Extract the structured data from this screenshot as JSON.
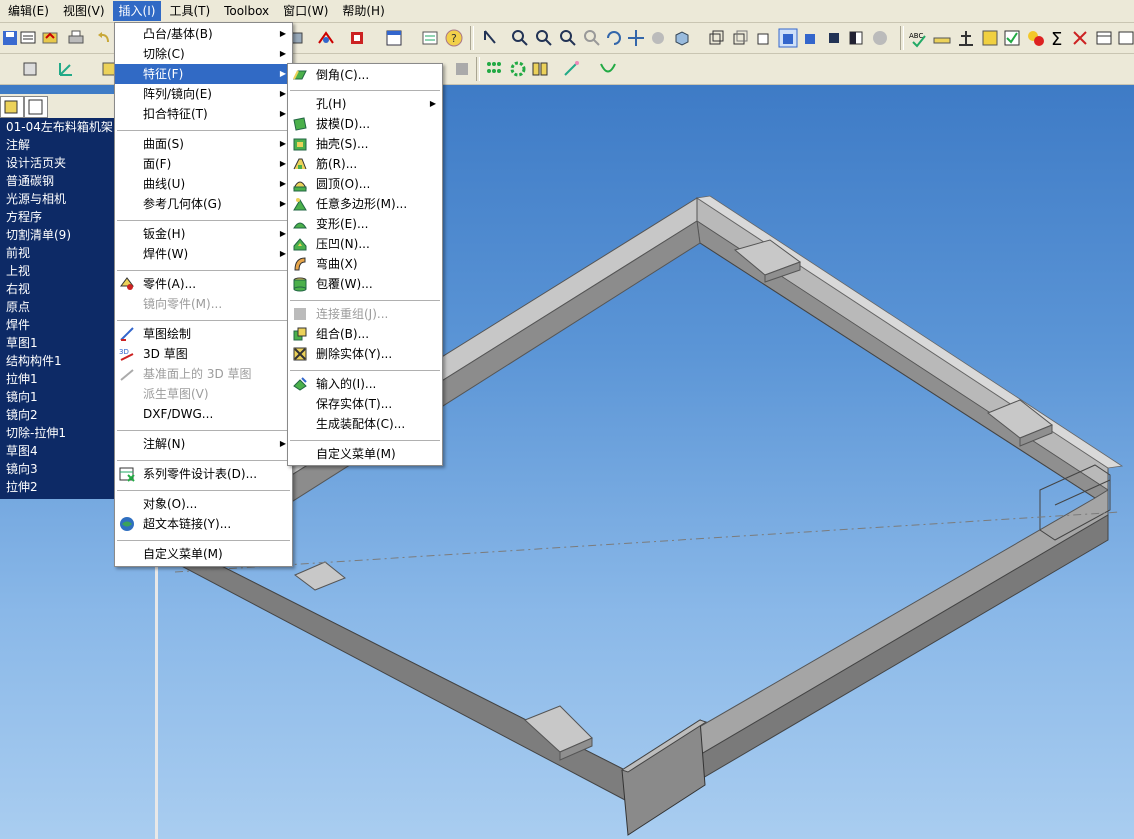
{
  "menubar": {
    "items": [
      "编辑(E)",
      "视图(V)",
      "插入(I)",
      "工具(T)",
      "Toolbox",
      "窗口(W)",
      "帮助(H)"
    ]
  },
  "tree": {
    "items": [
      "01-04左布料箱机架",
      "注解",
      "设计活页夹",
      "普通碳钢",
      "光源与相机",
      "方程序",
      "切割清单(9)",
      "前视",
      "上视",
      "右视",
      "原点",
      "焊件",
      "草图1",
      "结构构件1",
      "拉伸1",
      "镜向1",
      "镜向2",
      "切除-拉伸1",
      "草图4",
      "镜向3",
      "拉伸2"
    ]
  },
  "insert_menu": {
    "items": [
      {
        "label": "凸台/基体(B)",
        "submenu": true
      },
      {
        "label": "切除(C)",
        "submenu": true
      },
      {
        "label": "特征(F)",
        "submenu": true,
        "highlighted": true
      },
      {
        "label": "阵列/镜向(E)",
        "submenu": true
      },
      {
        "label": "扣合特征(T)",
        "submenu": true
      },
      {
        "label": "曲面(S)",
        "submenu": true
      },
      {
        "label": "面(F)",
        "submenu": true
      },
      {
        "label": "曲线(U)",
        "submenu": true
      },
      {
        "label": "参考几何体(G)",
        "submenu": true
      },
      {
        "label": "钣金(H)",
        "submenu": true
      },
      {
        "label": "焊件(W)",
        "submenu": true
      },
      {
        "label": "零件(A)...",
        "icon": "part-icon"
      },
      {
        "label": "镜向零件(M)...",
        "disabled": true
      },
      {
        "label": "草图绘制",
        "icon": "sketch-icon"
      },
      {
        "label": "3D 草图",
        "icon": "3d-sketch-icon"
      },
      {
        "label": "基准面上的 3D 草图",
        "disabled": true,
        "icon": "3d-sketch-plane-icon"
      },
      {
        "label": "派生草图(V)",
        "disabled": true
      },
      {
        "label": "DXF/DWG...",
        "icon": "none"
      },
      {
        "label": "注解(N)",
        "submenu": true
      },
      {
        "label": "系列零件设计表(D)...",
        "icon": "design-table-icon"
      },
      {
        "label": "对象(O)..."
      },
      {
        "label": "超文本链接(Y)...",
        "icon": "globe-icon"
      },
      {
        "label": "自定义菜单(M)"
      }
    ]
  },
  "feature_menu": {
    "items": [
      {
        "label": "倒角(C)...",
        "icon": "chamfer-icon"
      },
      {
        "label": "孔(H)",
        "submenu": true
      },
      {
        "label": "拔模(D)...",
        "icon": "draft-icon"
      },
      {
        "label": "抽壳(S)...",
        "icon": "shell-icon"
      },
      {
        "label": "筋(R)...",
        "icon": "rib-icon"
      },
      {
        "label": "圆顶(O)...",
        "icon": "dome-icon"
      },
      {
        "label": "任意多边形(M)...",
        "icon": "freeform-icon"
      },
      {
        "label": "变形(E)...",
        "icon": "deform-icon"
      },
      {
        "label": "压凹(N)...",
        "icon": "indent-icon"
      },
      {
        "label": "弯曲(X)",
        "icon": "flex-icon"
      },
      {
        "label": "包覆(W)...",
        "icon": "wrap-icon"
      },
      {
        "label": "连接重组(J)...",
        "disabled": true,
        "icon": "join-icon"
      },
      {
        "label": "组合(B)...",
        "icon": "combine-icon"
      },
      {
        "label": "删除实体(Y)...",
        "icon": "delete-body-icon"
      },
      {
        "label": "输入的(I)...",
        "icon": "import-icon"
      },
      {
        "label": "保存实体(T)..."
      },
      {
        "label": "生成装配体(C)..."
      },
      {
        "label": "自定义菜单(M)"
      }
    ]
  },
  "colors": {
    "menu_highlight": "#316ac5",
    "chrome": "#ece9d8",
    "tree_bg": "#0d2a66",
    "model_gray": "#9a9a9a"
  }
}
